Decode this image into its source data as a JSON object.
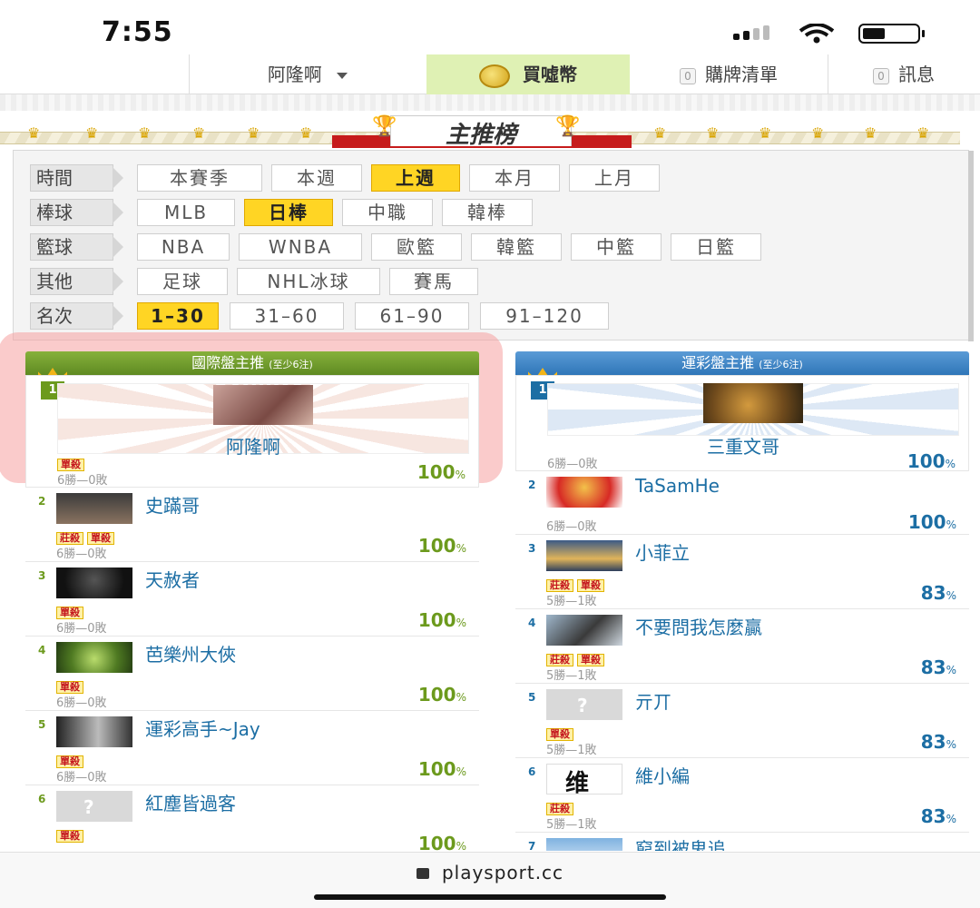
{
  "status": {
    "time": "7:55"
  },
  "nav": {
    "user": "阿隆啊",
    "buy": "買噓幣",
    "cart_count": "0",
    "cart": "購牌清單",
    "msg_count": "0",
    "msg": "訊息"
  },
  "banner": {
    "title": "主推榜"
  },
  "filters": {
    "time": {
      "label": "時間",
      "options": [
        "本賽季",
        "本週",
        "上週",
        "本月",
        "上月"
      ],
      "active": "上週"
    },
    "baseball": {
      "label": "棒球",
      "options": [
        "MLB",
        "日棒",
        "中職",
        "韓棒"
      ],
      "active": "日棒"
    },
    "basketball": {
      "label": "籃球",
      "options": [
        "NBA",
        "WNBA",
        "歐籃",
        "韓籃",
        "中籃",
        "日籃"
      ],
      "active": ""
    },
    "other": {
      "label": "其他",
      "options": [
        "足球",
        "NHL冰球",
        "賽馬"
      ],
      "active": ""
    },
    "rank": {
      "label": "名次",
      "options": [
        "1–30",
        "31–60",
        "61–90",
        "91–120"
      ],
      "active": "1–30"
    }
  },
  "left": {
    "title": "國際盤主推",
    "subtitle": "(至少6注)",
    "top": {
      "rank": "1",
      "name": "阿隆啊",
      "tags": [
        "單殺"
      ],
      "record": "6勝—0敗",
      "pct": "100",
      "pct_unit": "%"
    },
    "rows": [
      {
        "rank": "2",
        "name": "史蹣哥",
        "tags": [
          "莊殺",
          "單殺"
        ],
        "record": "6勝—0敗",
        "pct": "100",
        "pct_unit": "%"
      },
      {
        "rank": "3",
        "name": "天赦者",
        "tags": [
          "單殺"
        ],
        "record": "6勝—0敗",
        "pct": "100",
        "pct_unit": "%"
      },
      {
        "rank": "4",
        "name": "芭樂州大俠",
        "tags": [
          "單殺"
        ],
        "record": "6勝—0敗",
        "pct": "100",
        "pct_unit": "%"
      },
      {
        "rank": "5",
        "name": "運彩高手~Jay",
        "tags": [
          "單殺"
        ],
        "record": "6勝—0敗",
        "pct": "100",
        "pct_unit": "%"
      },
      {
        "rank": "6",
        "name": "紅塵皆過客",
        "tags": [
          "單殺"
        ],
        "record": "6勝—0敗",
        "pct": "100",
        "pct_unit": "%"
      }
    ]
  },
  "right": {
    "title": "運彩盤主推",
    "subtitle": "(至少6注)",
    "top": {
      "rank": "1",
      "name": "三重文哥",
      "tags": [],
      "record": "6勝—0敗",
      "pct": "100",
      "pct_unit": "%"
    },
    "rows": [
      {
        "rank": "2",
        "name": "TaSamHe",
        "tags": [],
        "record": "6勝—0敗",
        "pct": "100",
        "pct_unit": "%"
      },
      {
        "rank": "3",
        "name": "小菲立",
        "tags": [
          "莊殺",
          "單殺"
        ],
        "record": "5勝—1敗",
        "pct": "83",
        "pct_unit": "%"
      },
      {
        "rank": "4",
        "name": "不要問我怎麼贏",
        "tags": [
          "莊殺",
          "單殺"
        ],
        "record": "5勝—1敗",
        "pct": "83",
        "pct_unit": "%"
      },
      {
        "rank": "5",
        "name": "亓丌",
        "tags": [
          "單殺"
        ],
        "record": "5勝—1敗",
        "pct": "83",
        "pct_unit": "%"
      },
      {
        "rank": "6",
        "name": "維小編",
        "tags": [
          "莊殺"
        ],
        "record": "5勝—1敗",
        "pct": "83",
        "pct_unit": "%"
      },
      {
        "rank": "7",
        "name": "窮到被鬼追",
        "tags": [],
        "record": "",
        "pct": "",
        "pct_unit": ""
      }
    ]
  },
  "browser": {
    "url": "playsport.cc"
  },
  "colors": {
    "green_header": "#6f9a2b",
    "blue_header": "#3a84c4",
    "active_filter": "#ffd524",
    "highlight": "#f5a0a0"
  }
}
